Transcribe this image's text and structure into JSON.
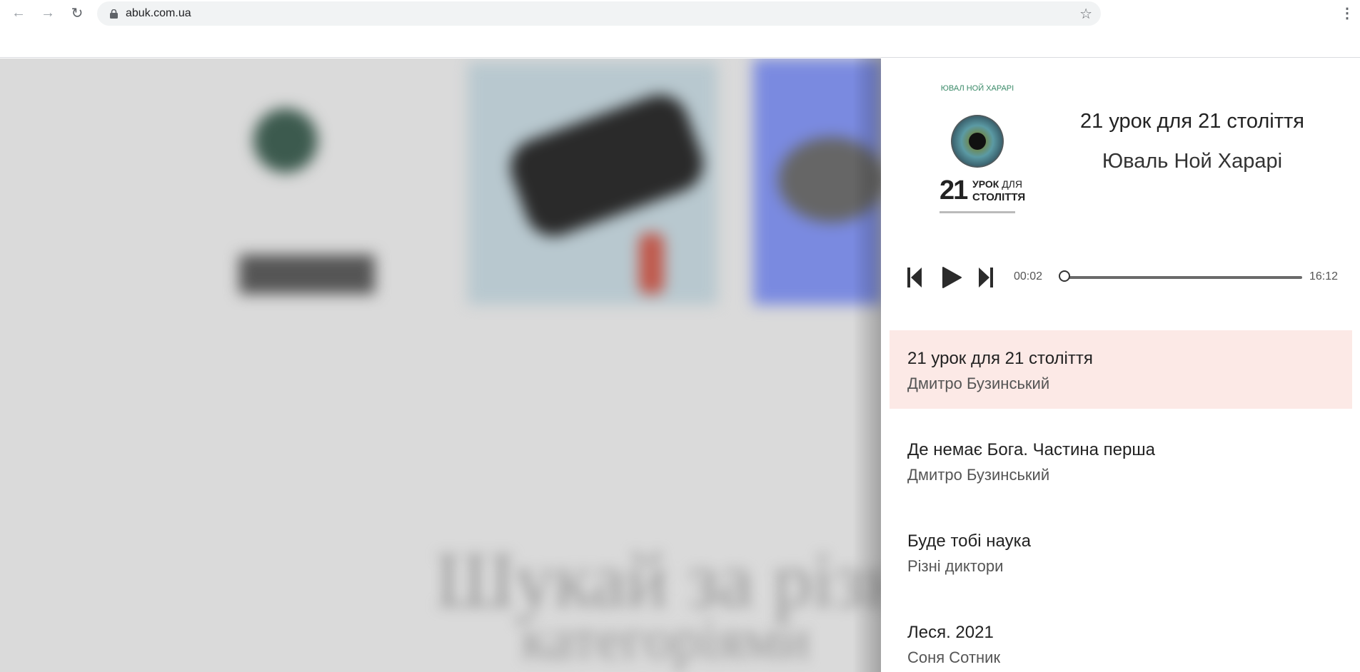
{
  "browser": {
    "url": "abuk.com.ua"
  },
  "player": {
    "cover": {
      "author_text": "ЮВАЛ НОЙ ХАРАРІ",
      "number": "21",
      "line1_bold": "УРОК",
      "line1_thin": "ДЛЯ",
      "line2": "СТОЛІТТЯ"
    },
    "now_playing": {
      "title": "21 урок для 21 століття",
      "author": "Юваль Ной Харарі"
    },
    "elapsed": "00:02",
    "duration": "16:12",
    "progress": 0.002
  },
  "playlist": [
    {
      "title": "21 урок для 21 століття",
      "author": "Дмитро Бузинський",
      "active": true
    },
    {
      "title": "Де немає Бога. Частина перша",
      "author": "Дмитро Бузинський",
      "active": false
    },
    {
      "title": "Буде тобі наука",
      "author": "Різні диктори",
      "active": false
    },
    {
      "title": "Леся. 2021",
      "author": "Соня Сотник",
      "active": false
    }
  ],
  "background": {
    "headline_line1": "Шукай за різними",
    "headline_line2": "категоріями"
  }
}
